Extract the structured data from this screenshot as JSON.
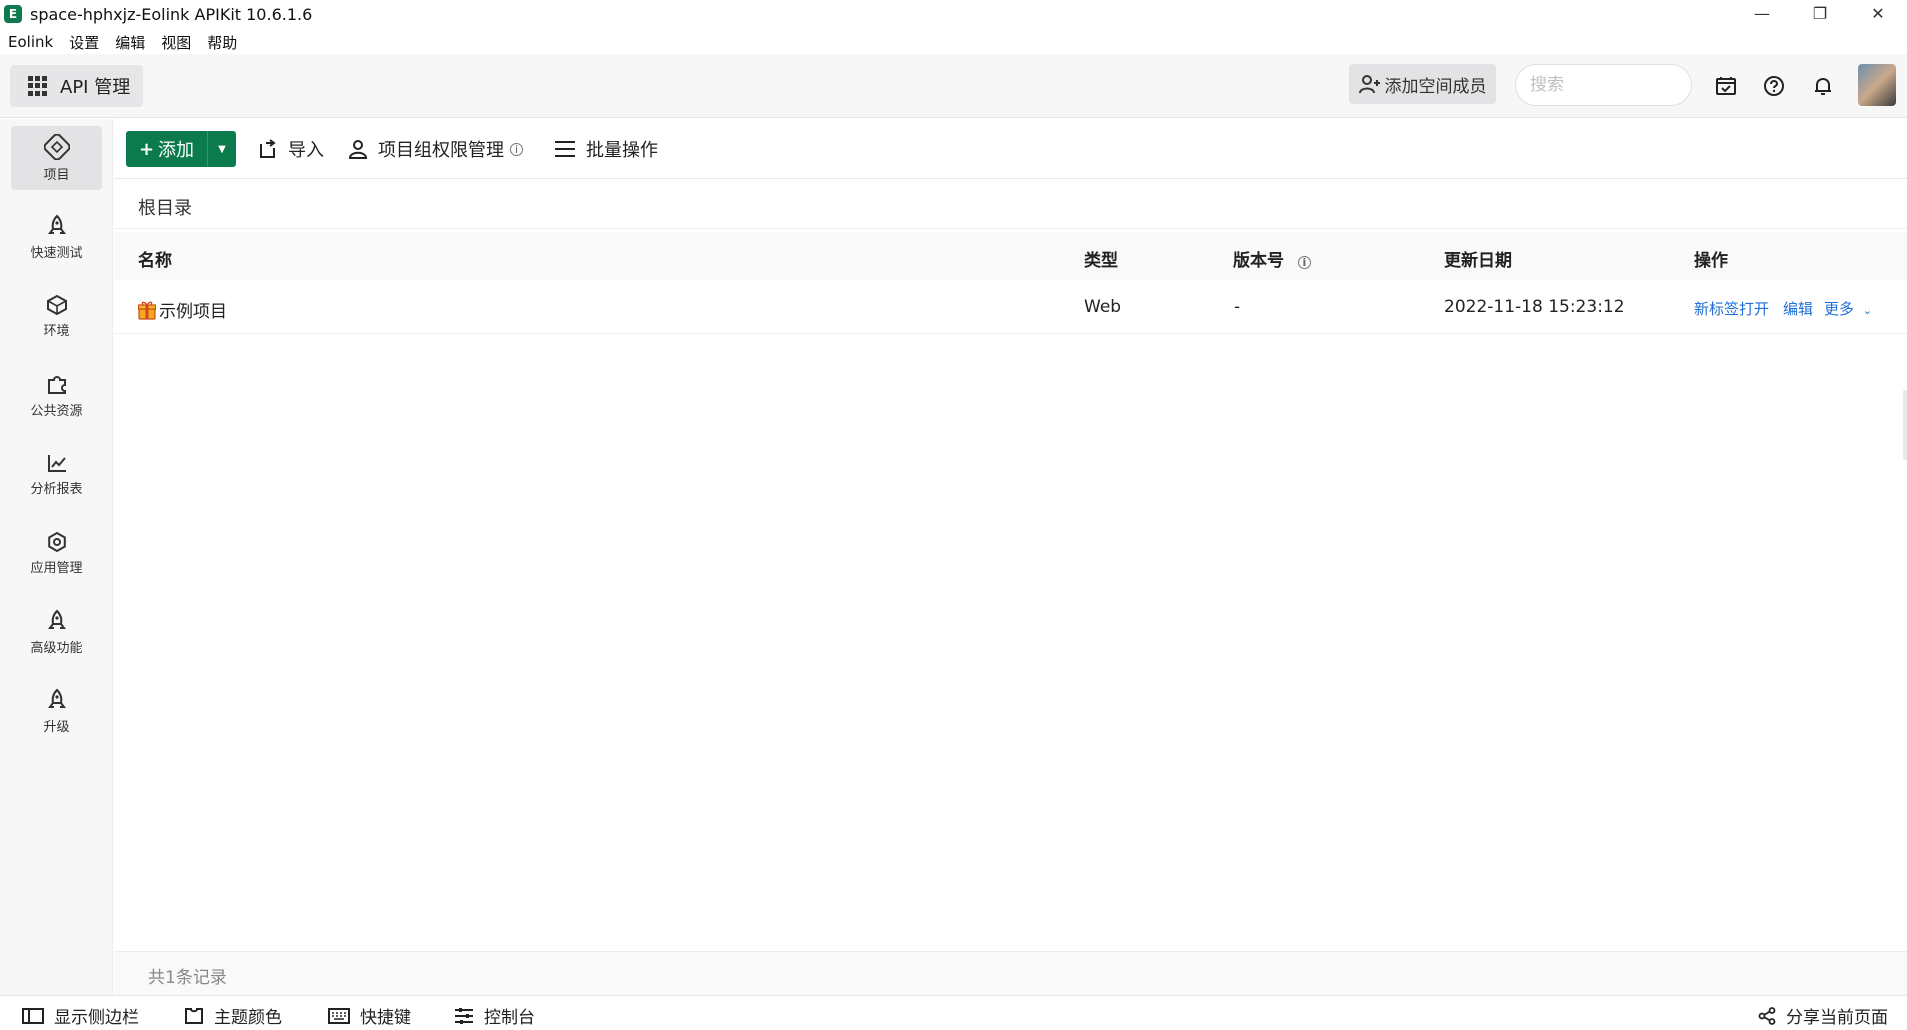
{
  "window": {
    "title": "space-hphxjz-Eolink APIKit 10.6.1.6",
    "logo_letter": "E",
    "minimize": "—",
    "restore": "❐",
    "close": "✕"
  },
  "menu": [
    "Eolink",
    "设置",
    "编辑",
    "视图",
    "帮助"
  ],
  "header": {
    "module_label": "API 管理",
    "add_member_label": "添加空间成员",
    "search_placeholder": "搜索"
  },
  "sidebar": {
    "items": [
      {
        "label": "项目",
        "icon": "project-icon",
        "active": true
      },
      {
        "label": "快速测试",
        "icon": "rocket-icon"
      },
      {
        "label": "环境",
        "icon": "environment-icon"
      },
      {
        "label": "公共资源",
        "icon": "puzzle-icon"
      },
      {
        "label": "分析报表",
        "icon": "chart-icon"
      },
      {
        "label": "应用管理",
        "icon": "gear-icon"
      },
      {
        "label": "高级功能",
        "icon": "rocket-icon"
      },
      {
        "label": "升级",
        "icon": "rocket-icon"
      }
    ]
  },
  "toolbar": {
    "add_label": "添加",
    "import_label": "导入",
    "permission_label": "项目组权限管理",
    "batch_label": "批量操作"
  },
  "breadcrumb": "根目录",
  "table": {
    "columns": [
      "名称",
      "类型",
      "版本号",
      "更新日期",
      "操作"
    ],
    "rows": [
      {
        "name": "示例项目",
        "type": "Web",
        "version": "-",
        "updated": "2022-11-18 15:23:12",
        "actions": {
          "open_new_tab": "新标签打开",
          "edit": "编辑",
          "more": "更多"
        }
      }
    ]
  },
  "record_count": "共1条记录",
  "statusbar": {
    "show_sidebar": "显示侧边栏",
    "theme_color": "主题颜色",
    "shortcuts": "快捷键",
    "console": "控制台",
    "share_page": "分享当前页面"
  },
  "colors": {
    "accent_green": "#0b7a4c",
    "link_blue": "#1f6fd6",
    "sidebar_bg": "#f7f7f8"
  }
}
